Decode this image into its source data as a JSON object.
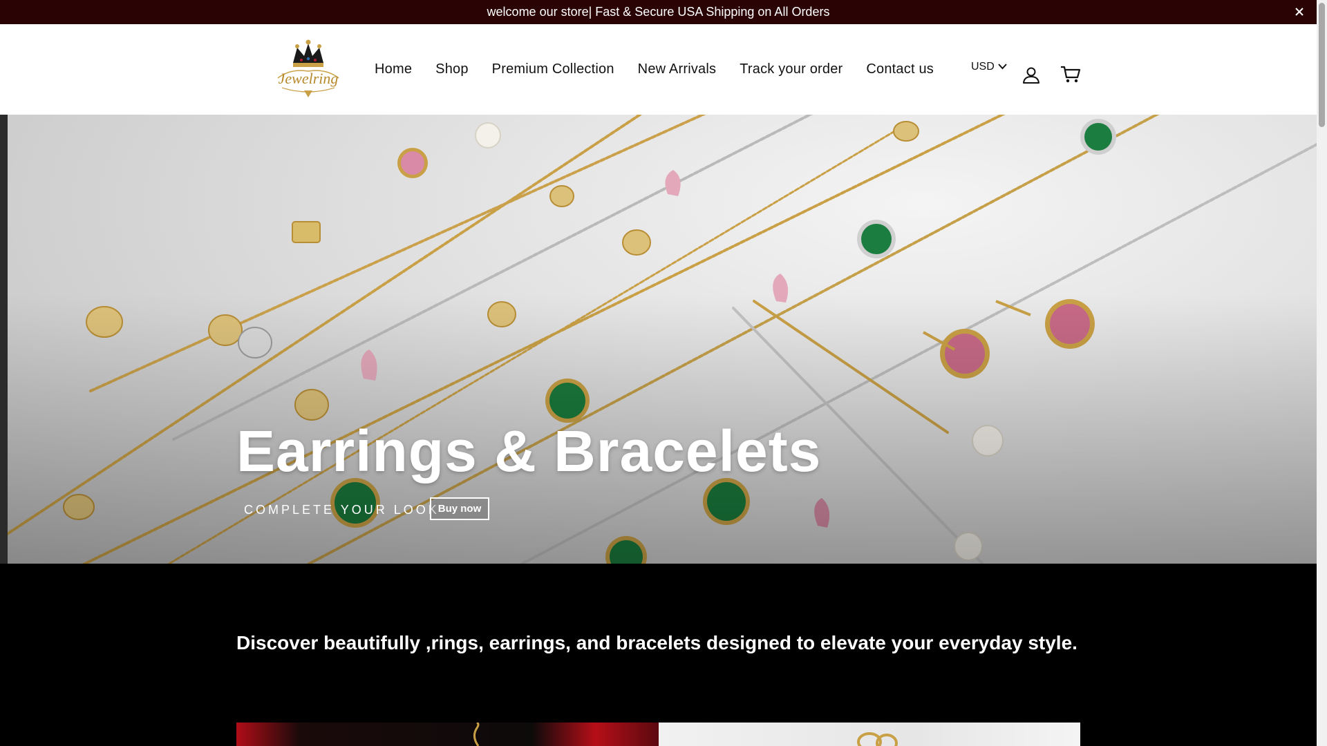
{
  "announcement": {
    "text": "welcome our store| Fast & Secure USA Shipping on All Orders",
    "close_icon": "close-icon"
  },
  "header": {
    "logo_text": "Jewelring",
    "nav": [
      "Home",
      "Shop",
      "Premium Collection",
      "New Arrivals",
      "Track your order",
      "Contact us"
    ],
    "currency": "USD",
    "icons": [
      "account-icon",
      "cart-icon",
      "chevron-down-icon"
    ]
  },
  "hero": {
    "title": "Earrings & Bracelets",
    "subtitle": "COMPLETE YOUR LOOK",
    "button_label": "Buy now"
  },
  "intro": {
    "text": "Discover beautifully ,rings, earrings, and bracelets designed to elevate your everyday style."
  },
  "colors": {
    "announcement_bg": "#2a0305",
    "gold": "#c9a045",
    "emerald": "#1a7a3c",
    "pink": "#d98aa6"
  }
}
